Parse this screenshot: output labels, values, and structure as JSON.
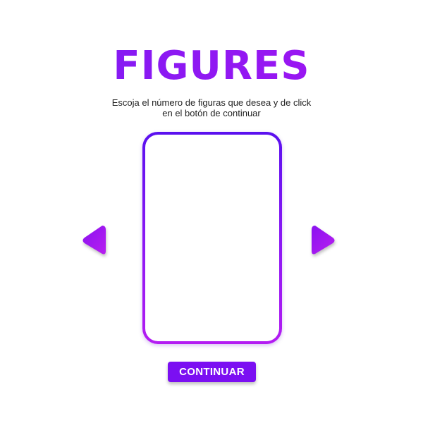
{
  "header": {
    "title": "FIGURES",
    "instructions": "Escoja el número de figuras que desea y de click en el botón de continuar"
  },
  "carousel": {
    "prev_icon": "triangle-left-icon",
    "next_icon": "triangle-right-icon",
    "card_border_colors": [
      "#5a10ef",
      "#b41cf2"
    ],
    "arrow_colors": [
      "#8a12f0",
      "#b81ff0"
    ]
  },
  "actions": {
    "continue_label": "CONTINUAR",
    "continue_color": "#7b0ff2"
  }
}
